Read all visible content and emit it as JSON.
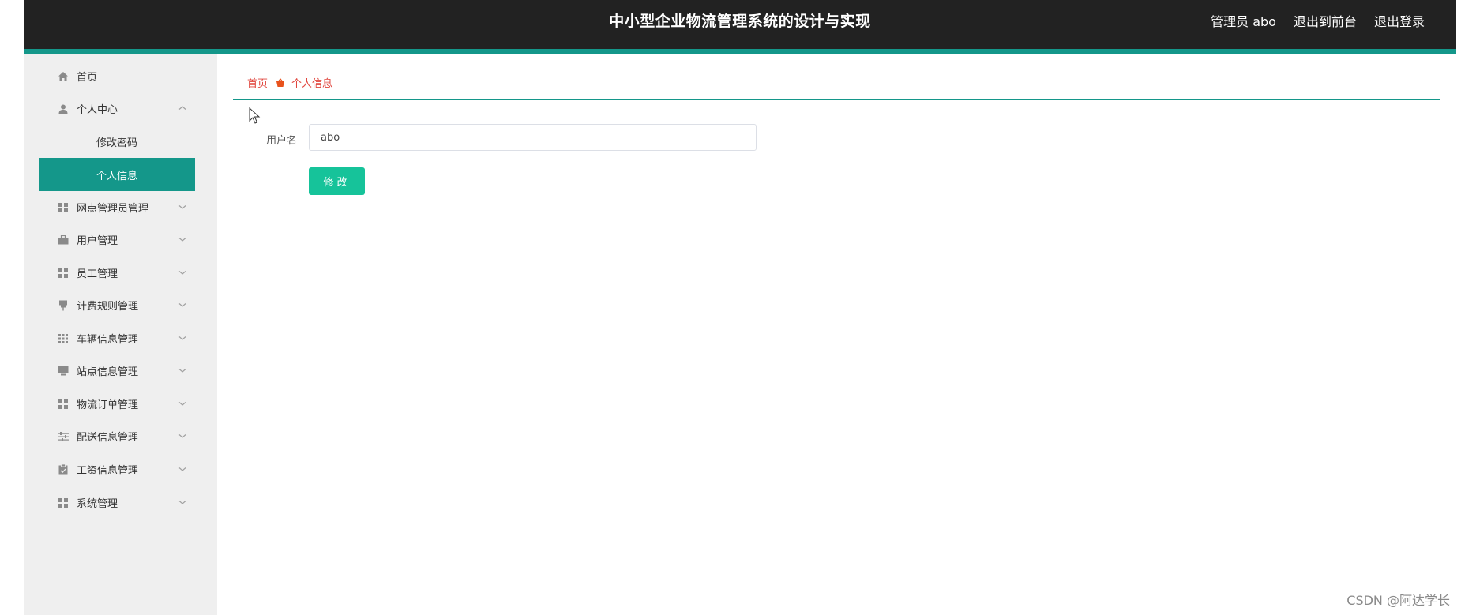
{
  "header": {
    "title": "中小型企业物流管理系统的设计与实现",
    "user_label": "管理员 abo",
    "front_link": "退出到前台",
    "logout_link": "退出登录"
  },
  "sidebar": {
    "items": [
      {
        "label": "首页",
        "icon": "home-icon"
      },
      {
        "label": "个人中心",
        "icon": "user-icon",
        "expanded": true,
        "children": [
          {
            "label": "修改密码"
          },
          {
            "label": "个人信息",
            "active": true
          }
        ]
      },
      {
        "label": "网点管理员管理",
        "icon": "grid-icon"
      },
      {
        "label": "用户管理",
        "icon": "briefcase-icon"
      },
      {
        "label": "员工管理",
        "icon": "grid-icon"
      },
      {
        "label": "计费规则管理",
        "icon": "pin-icon"
      },
      {
        "label": "车辆信息管理",
        "icon": "apps-icon"
      },
      {
        "label": "站点信息管理",
        "icon": "monitor-icon"
      },
      {
        "label": "物流订单管理",
        "icon": "grid-icon"
      },
      {
        "label": "配送信息管理",
        "icon": "sliders-icon"
      },
      {
        "label": "工资信息管理",
        "icon": "clipboard-icon"
      },
      {
        "label": "系统管理",
        "icon": "grid-icon"
      }
    ]
  },
  "breadcrumb": {
    "home": "首页",
    "current": "个人信息"
  },
  "form": {
    "username_label": "用户名",
    "username_value": "abo",
    "submit_label": "修改"
  },
  "watermark": "CSDN @阿达学长",
  "colors": {
    "header_bg": "#222222",
    "accent": "#14978a",
    "button": "#16c39a",
    "breadcrumb": "#e0443c"
  }
}
